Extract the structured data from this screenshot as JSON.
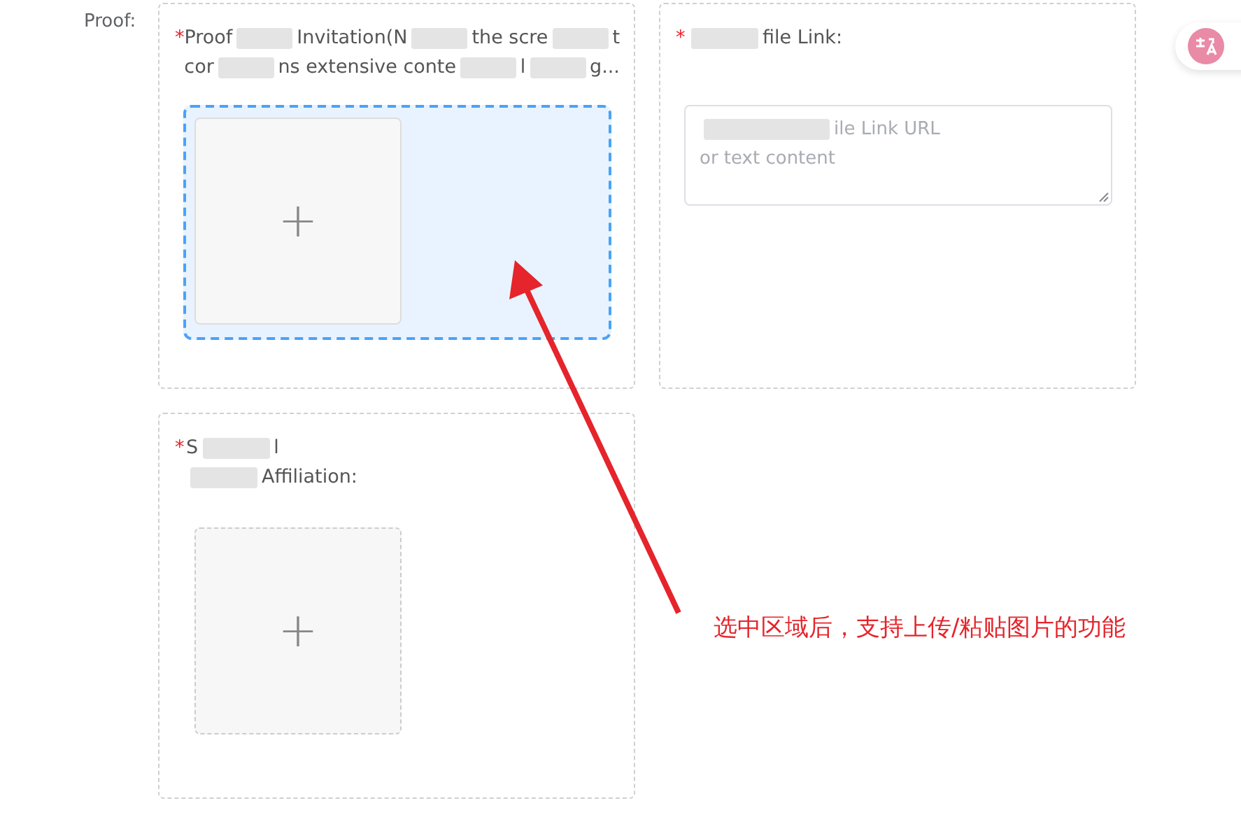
{
  "field_label": "Proof:",
  "cards": [
    {
      "kind": "upload",
      "required_mark": "*",
      "label_lines": [
        [
          {
            "text": "Proof"
          },
          {
            "kind": "redacted"
          },
          {
            "text": "Invitation(N"
          },
          {
            "kind": "redacted"
          },
          {
            "text": "the scre"
          },
          {
            "kind": "redacted"
          },
          {
            "text": "t"
          }
        ],
        [
          {
            "text": "cor"
          },
          {
            "kind": "redacted"
          },
          {
            "text": "ns extensive conte"
          },
          {
            "kind": "redacted"
          },
          {
            "text": "l"
          },
          {
            "kind": "redacted"
          },
          {
            "text": "g..."
          }
        ]
      ],
      "upload": {
        "selected": true,
        "plus": "+"
      }
    },
    {
      "kind": "link",
      "required_mark": "*",
      "label_lines": [
        [
          {
            "kind": "redacted"
          },
          {
            "text": "file Link:"
          }
        ]
      ],
      "placeholder_lines": [
        [
          {
            "kind": "redacted"
          },
          {
            "text": "ile Link URL"
          }
        ],
        [
          {
            "text": "or text content"
          }
        ]
      ]
    },
    {
      "kind": "upload",
      "required_mark": "*",
      "label_lines": [
        [
          {
            "text": "S"
          },
          {
            "kind": "redacted"
          },
          {
            "text": "l"
          }
        ],
        [
          {
            "kind": "redacted"
          },
          {
            "text": "Affiliation:"
          }
        ]
      ],
      "upload": {
        "selected": false,
        "plus": "+"
      }
    }
  ],
  "annotation": {
    "text": "选中区域后，支持上传/粘贴图片的功能"
  }
}
